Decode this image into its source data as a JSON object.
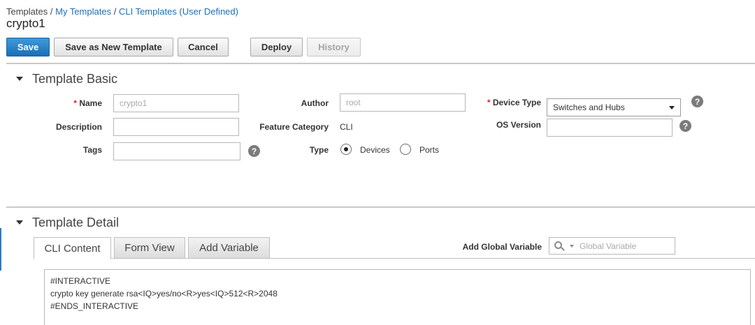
{
  "breadcrumb": {
    "root": "Templates",
    "sep": "/",
    "items": [
      "My Templates",
      "CLI Templates (User Defined)"
    ]
  },
  "page_title": "crypto1",
  "toolbar": {
    "save": "Save",
    "save_as_new": "Save as New Template",
    "cancel": "Cancel",
    "deploy": "Deploy",
    "history": "History"
  },
  "template_basic": {
    "title": "Template Basic",
    "required_marker": "*",
    "name_label": "Name",
    "name_value": "crypto1",
    "author_label": "Author",
    "author_value": "root",
    "device_type_label": "Device Type",
    "device_type_value": "Switches and Hubs",
    "description_label": "Description",
    "description_value": "",
    "feature_category_label": "Feature Category",
    "feature_category_value": "CLI",
    "os_version_label": "OS Version",
    "os_version_value": "",
    "tags_label": "Tags",
    "tags_value": "",
    "type_label": "Type",
    "type_options": [
      "Devices",
      "Ports"
    ],
    "type_selected": "Devices",
    "help_glyph": "?"
  },
  "template_detail": {
    "title": "Template Detail",
    "tabs": [
      "CLI Content",
      "Form View",
      "Add Variable"
    ],
    "active_tab": "CLI Content",
    "add_global_variable_label": "Add Global Variable",
    "global_variable_placeholder": "Global Variable",
    "cli_lines": [
      "#INTERACTIVE",
      "crypto key generate rsa<IQ>yes/no<R>yes<IQ>512<R>2048",
      "#ENDS_INTERACTIVE"
    ]
  },
  "colors": {
    "primary_button": "#1a6fb8",
    "link": "#1f6fb2",
    "required": "#d9252a",
    "divider": "#c9c9c9"
  },
  "icons": [
    "help-icon",
    "search-icon",
    "chevron-down-icon",
    "collapse-triangle-icon"
  ]
}
